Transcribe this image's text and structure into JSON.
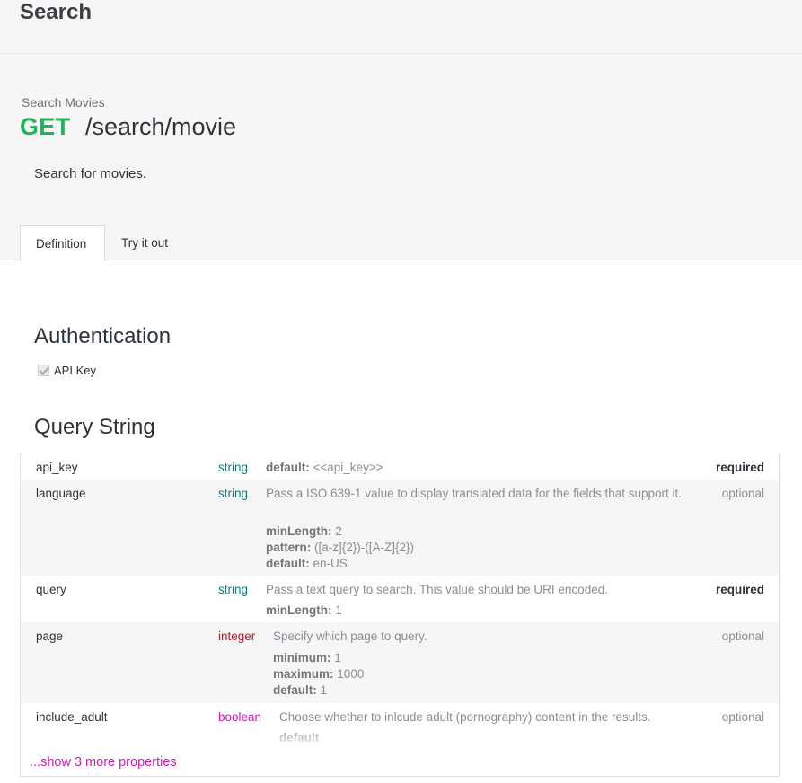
{
  "page_title": "Search",
  "operation": {
    "summary": "Search Movies",
    "method": "GET",
    "path": "/search/movie",
    "description": "Search for movies."
  },
  "tabs": [
    {
      "label": "Definition",
      "active": true
    },
    {
      "label": "Try it out",
      "active": false
    }
  ],
  "authentication": {
    "title": "Authentication",
    "items": [
      {
        "label": "API Key",
        "checked": true
      }
    ]
  },
  "query_string": {
    "title": "Query String",
    "params": [
      {
        "name": "api_key",
        "type": "string",
        "default_label": "default:",
        "default_value": "<<api_key>>",
        "requirement": "required"
      },
      {
        "name": "language",
        "type": "string",
        "description": "Pass a ISO 639-1 value to display translated data for the fields that support it.",
        "min_length_label": "minLength:",
        "min_length": "2",
        "pattern_label": "pattern:",
        "pattern": "([a-z]{2})-([A-Z]{2})",
        "default_label": "default:",
        "default_value": "en-US",
        "requirement": "optional"
      },
      {
        "name": "query",
        "type": "string",
        "description": "Pass a text query to search. This value should be URI encoded.",
        "min_length_label": "minLength:",
        "min_length": "1",
        "requirement": "required"
      },
      {
        "name": "page",
        "type": "integer",
        "description": "Specify which page to query.",
        "minimum_label": "minimum:",
        "minimum": "1",
        "maximum_label": "maximum:",
        "maximum": "1000",
        "default_label": "default:",
        "default_value": "1",
        "requirement": "optional"
      },
      {
        "name": "include_adult",
        "type": "boolean",
        "description": "Choose whether to inlcude adult (pornography) content in the results.",
        "default_label": "default",
        "requirement": "optional"
      }
    ],
    "show_more": "...show 3 more properties"
  },
  "colors": {
    "method_get": "#20b45a",
    "type_string": "#137a7a",
    "type_integer": "#b01c2e",
    "type_boolean": "#d219b8",
    "link": "#d219b8"
  }
}
